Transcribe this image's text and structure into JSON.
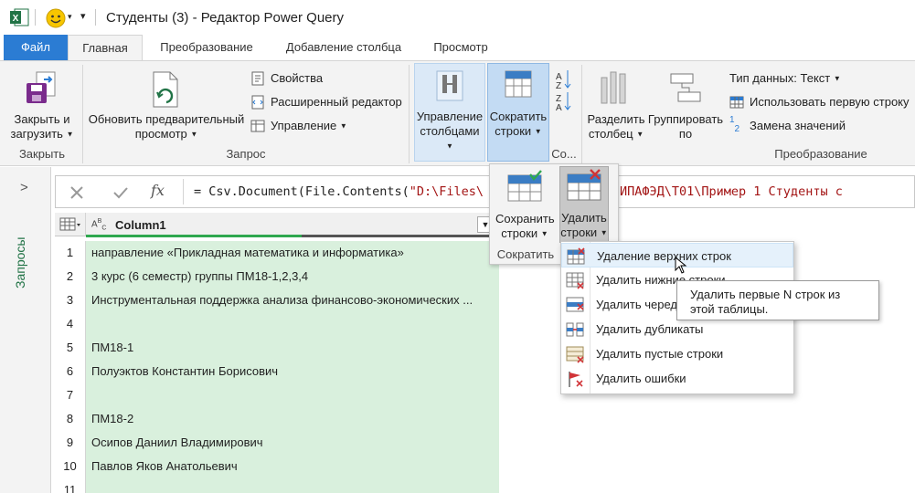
{
  "window": {
    "title": "Студенты (3) - Редактор Power Query",
    "accent": "#217346"
  },
  "tabs": [
    {
      "label": "Файл"
    },
    {
      "label": "Главная"
    },
    {
      "label": "Преобразование"
    },
    {
      "label": "Добавление столбца"
    },
    {
      "label": "Просмотр"
    }
  ],
  "ribbon": {
    "close_load": {
      "line1": "Закрыть и",
      "line2": "загрузить",
      "group": "Закрыть"
    },
    "refresh": {
      "line1": "Обновить предварительный",
      "line2": "просмотр",
      "group": "Запрос"
    },
    "properties": "Свойства",
    "advanced_editor": "Расширенный редактор",
    "manage": "Управление",
    "manage_columns": {
      "line1": "Управление",
      "line2": "столбцами"
    },
    "reduce_rows": {
      "line1": "Сократить",
      "line2": "строки"
    },
    "sort_group": "Со...",
    "split_column": {
      "line1": "Разделить",
      "line2": "столбец"
    },
    "group_by": {
      "line1": "Группировать",
      "line2": "по"
    },
    "data_type": "Тип данных: Текст",
    "use_first_row": "Использовать первую строку",
    "replace_values": "Замена значений",
    "transform_group": "Преобразование"
  },
  "queries_pane": {
    "label": "Запросы"
  },
  "formula": {
    "prefix": "= Csv.Document(File.Contents(\"D:\\Files\\",
    "suffix": "ИПАФЭД\\T01\\Пример 1 Студенты с"
  },
  "grid": {
    "column_header": "Column1",
    "rows": [
      {
        "n": "1",
        "value": "направление «Прикладная математика и информатика»"
      },
      {
        "n": "2",
        "value": "3 курс (6 семестр) группы ПМ18-1,2,3,4"
      },
      {
        "n": "3",
        "value": "Инструментальная поддержка анализа финансово-экономических ..."
      },
      {
        "n": "4",
        "value": ""
      },
      {
        "n": "5",
        "value": "ПМ18-1"
      },
      {
        "n": "6",
        "value": "Полуэктов Константин Борисович"
      },
      {
        "n": "7",
        "value": ""
      },
      {
        "n": "8",
        "value": "ПМ18-2"
      },
      {
        "n": "9",
        "value": "Осипов Даниил Владимирович"
      },
      {
        "n": "10",
        "value": "Павлов Яков Анатольевич"
      },
      {
        "n": "11",
        "value": ""
      }
    ]
  },
  "reduce_popup": {
    "keep_rows": {
      "line1": "Сохранить",
      "line2": "строки"
    },
    "remove_rows": {
      "line1": "Удалить",
      "line2": "строки"
    },
    "group": "Сократить"
  },
  "remove_menu": {
    "items": [
      {
        "label": "Удаление верхних строк",
        "icon": "remove-top-rows-icon"
      },
      {
        "label": "Удалить нижние строки",
        "icon": "remove-bottom-rows-icon"
      },
      {
        "label": "Удалить чередующиеся строки",
        "icon": "remove-alternate-rows-icon"
      },
      {
        "label": "Удалить дубликаты",
        "icon": "remove-duplicates-icon"
      },
      {
        "label": "Удалить пустые строки",
        "icon": "remove-blank-rows-icon"
      },
      {
        "label": "Удалить ошибки",
        "icon": "remove-errors-icon"
      }
    ]
  },
  "tooltip": {
    "text": "Удалить первые N строк из этой таблицы."
  }
}
